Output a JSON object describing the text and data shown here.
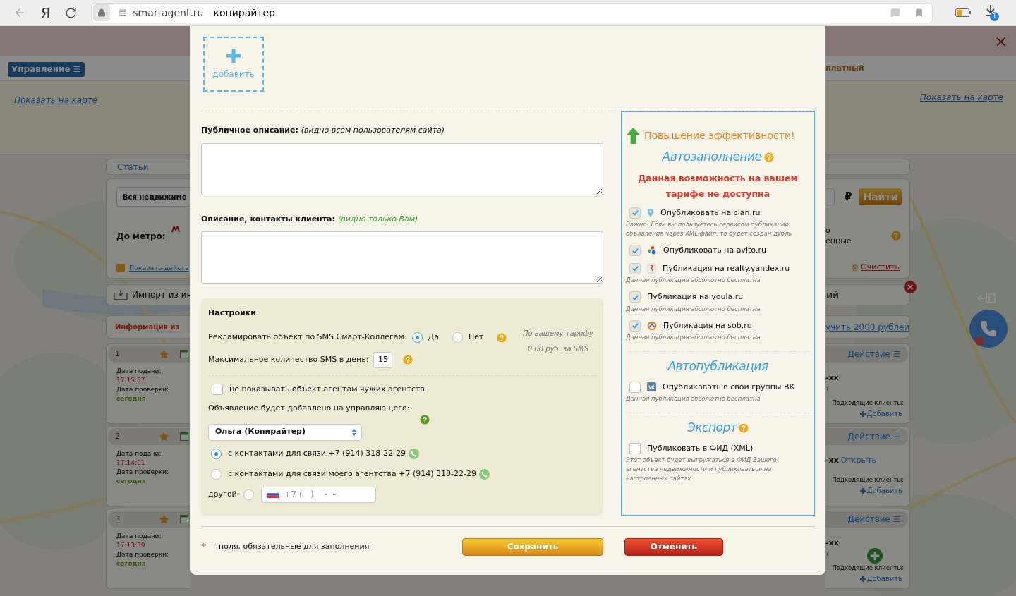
{
  "browser": {
    "logo_letter": "Я",
    "domain": "smartagent.ru",
    "page_title": "копирайтер",
    "download_count": "1"
  },
  "background": {
    "close_glyph": "×",
    "manage_button": "Управление",
    "tariff_fragment": "платный",
    "map_links": [
      "Показать на карте",
      "Показать на карте"
    ],
    "articles_tab": "Статьи",
    "property_select": "Вся недвижимо",
    "currency": "₽",
    "search_button": "Найти",
    "metro_label": "До метро:",
    "option_fragments": [
      "о",
      "енные"
    ],
    "show_actions": {
      "label": "Показать действ",
      "checked": true
    },
    "clear_link": "Очистить",
    "import_label": "Импорт из ин",
    "import_fragment": "ий",
    "info_title": "Информация из",
    "bonus_link": "учить 2000 рублей",
    "listings": [
      {
        "number": "1",
        "submitted_label": "Дата подачи:",
        "submitted_time": "17:15:57",
        "checked_label": "Дата проверки:",
        "checked_value": "сегодня",
        "action": "Действие",
        "phone_fragment": "-xx",
        "extra": {
          "kind": "text",
          "text": "т"
        },
        "clients_label": "Подходящие клиенты:",
        "add_label": "Добавить"
      },
      {
        "number": "2",
        "submitted_label": "Дата подачи:",
        "submitted_time": "17:14:01",
        "checked_label": "Дата проверки:",
        "checked_value": "сегодня",
        "action": "Действие",
        "phone_fragment": "-xx",
        "extra": {
          "kind": "link",
          "text": "Открыть"
        },
        "clients_label": "Подходящие клиенты:",
        "add_label": "Добавить"
      },
      {
        "number": "3",
        "submitted_label": "Дата подачи:",
        "submitted_time": "17:13:39",
        "checked_label": "Дата проверки:",
        "checked_value": "сегодня",
        "action": "Действие",
        "phone_fragment": "-xx",
        "extra": {
          "kind": "text",
          "text": "т"
        },
        "clients_label": "Подходящие клиенты:",
        "add_label": "Добавить"
      }
    ]
  },
  "modal": {
    "add_photo": "добавить",
    "public_description": {
      "label": "Публичное описание:",
      "hint": "(видно всем пользователям сайта)"
    },
    "client_description": {
      "label": "Описание, контакты клиента:",
      "hint": "(видно только Вам)"
    },
    "settings": {
      "title": "Настройки",
      "sms_label": "Рекламировать объект по SMS Смарт-Коллегам:",
      "sms_options": [
        {
          "label": "Да",
          "selected": true
        },
        {
          "label": "Нет",
          "selected": false
        }
      ],
      "tariff_note": [
        "По вашему тарифу",
        "0.00 руб. за SMS"
      ],
      "max_sms_label": "Максимальное количество SMS в день:",
      "max_sms_value": "15",
      "hide_from_agents": {
        "label": "не показывать объект агентам чужих агентств",
        "checked": false
      },
      "manager_label": "Объявление будет добавлено на управляющего:",
      "manager_value": "Ольга (Копирайтер)",
      "contact_options": [
        {
          "kind": "phone",
          "label": "с контактами для связи +7 (914) 318-22-29",
          "selected": true
        },
        {
          "kind": "phone",
          "label": "с контактами для связи моего агентства +7 (914) 318-22-29",
          "selected": false
        },
        {
          "kind": "other",
          "label": "другой:",
          "selected": false,
          "placeholder": "+7 (   )    -  -"
        }
      ]
    },
    "promo": {
      "title": "Повышение эффективности!",
      "sections": [
        {
          "title": "Автозаполнение",
          "help": true,
          "warning": "Данная возможность на вашем тарифе не доступна",
          "items": [
            {
              "kind": "pin",
              "label": "Опубликовать на cian.ru",
              "checked": true,
              "note": "Важно! Если вы пользуетесь сервисом публикации объявления через XML-файл, то будет создан дубль"
            },
            {
              "kind": "dots",
              "label": "Опубликовать на avito.ru",
              "checked": true
            },
            {
              "kind": "card",
              "label": "Публикация на realty.yandex.ru",
              "checked": true,
              "note": "Данная публикация абсолютно бесплатна"
            },
            {
              "kind": "plain",
              "label": "Публикация на youla.ru",
              "checked": true,
              "note": "Данная публикация абсолютно бесплатна"
            },
            {
              "kind": "ring",
              "label": "Публикация на sob.ru",
              "checked": true,
              "note": "Данная публикация абсолютно бесплатна"
            }
          ]
        },
        {
          "title": "Автопубликация",
          "help": false,
          "items": [
            {
              "kind": "square",
              "label": "Опубликовать в свои группы ВК",
              "checked": false,
              "note": "Данная публикация абсолютно бесплатна"
            }
          ]
        },
        {
          "title": "Экспорт",
          "help": true,
          "items": [
            {
              "kind": "plain",
              "label": "Публиковать в ФИД (XML)",
              "checked": false,
              "note": "Этот объект будет выгружаться в ФИД Вашего агентства недвижимости и публиковаться на настроенных сайтах"
            }
          ]
        }
      ]
    },
    "footer": {
      "required_mark": "*",
      "required_note": "— поля, обязательные для заполнения",
      "save": "Сохранить",
      "cancel": "Отменить"
    }
  }
}
